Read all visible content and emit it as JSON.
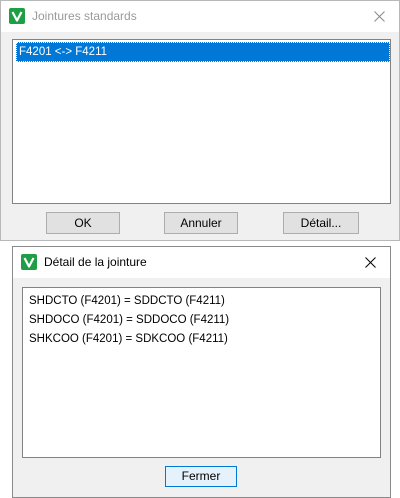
{
  "window_main": {
    "title": "Jointures standards",
    "icon": "app-v-icon",
    "list_items": [
      "F4201 <-> F4211"
    ],
    "buttons": {
      "ok": "OK",
      "cancel": "Annuler",
      "detail": "Détail..."
    }
  },
  "window_detail": {
    "title": "Détail de la jointure",
    "icon": "app-v-icon",
    "lines": [
      "SHDCTO (F4201) = SDDCTO (F4211)",
      "SHDOCO (F4201) = SDDOCO (F4211)",
      "SHKCOO (F4201) = SDKCOO (F4211)"
    ],
    "buttons": {
      "close": "Fermer"
    }
  },
  "colors": {
    "selection": "#0078d7",
    "icon_green": "#1e9f45",
    "window_bg": "#f0f0f0"
  }
}
